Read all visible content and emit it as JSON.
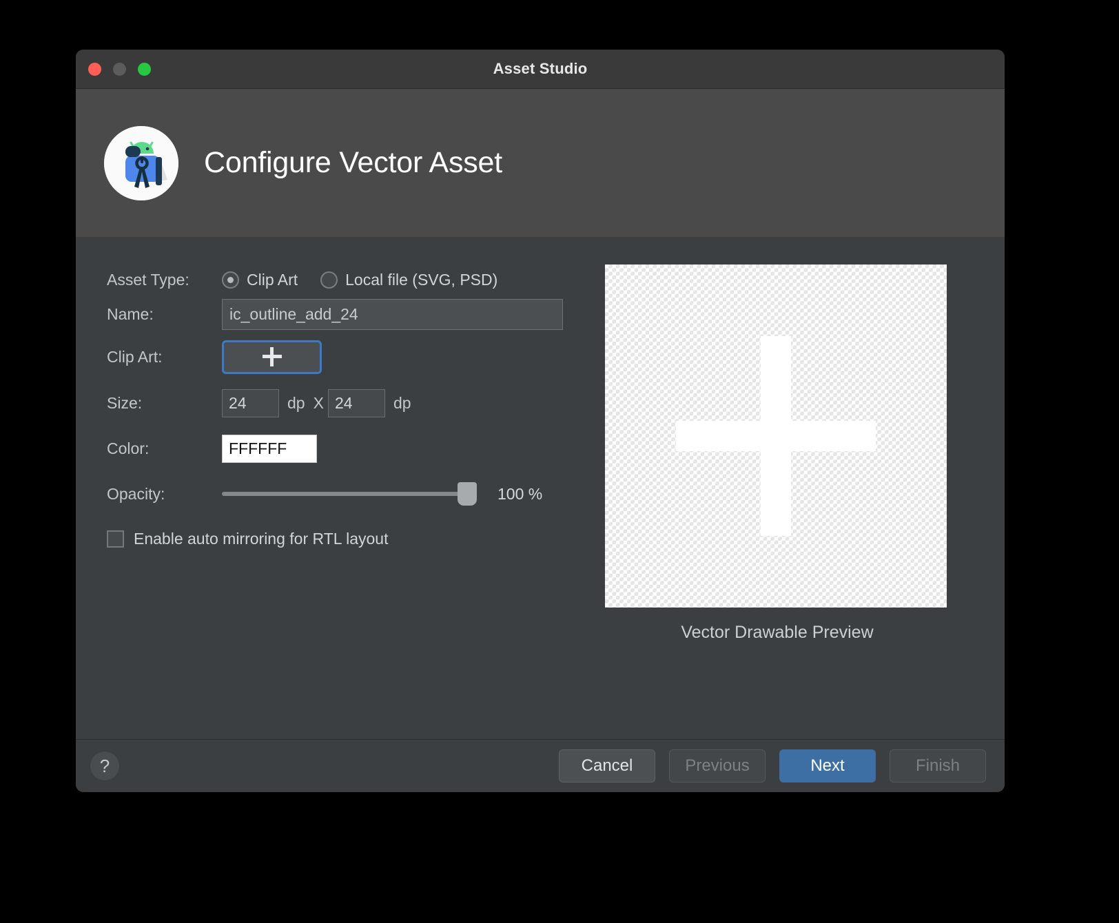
{
  "window": {
    "title": "Asset Studio",
    "traffic_lights": [
      "close",
      "minimize",
      "zoom"
    ]
  },
  "header": {
    "title": "Configure Vector Asset",
    "logo_icon": "android-studio-logo-icon"
  },
  "form": {
    "asset_type": {
      "label": "Asset Type:",
      "options": [
        {
          "label": "Clip Art",
          "selected": true
        },
        {
          "label": "Local file (SVG, PSD)",
          "selected": false
        }
      ]
    },
    "name": {
      "label": "Name:",
      "value": "ic_outline_add_24",
      "placeholder": "Name"
    },
    "clip_art": {
      "label": "Clip Art:",
      "button_icon": "plus-icon"
    },
    "size": {
      "label": "Size:",
      "width": "24",
      "height": "24",
      "unit_width": "dp",
      "unit_height": "dp",
      "separator": "X"
    },
    "color": {
      "label": "Color:",
      "value": "FFFFFF",
      "swatch_hex": "#FFFFFF"
    },
    "opacity": {
      "label": "Opacity:",
      "value": 100,
      "value_text": "100 %",
      "min": 0,
      "max": 100
    },
    "rtl": {
      "label": "Enable auto mirroring for RTL layout",
      "checked": false
    }
  },
  "preview": {
    "caption": "Vector Drawable Preview",
    "drawable_icon": "plus-icon"
  },
  "footer": {
    "help_label": "?",
    "buttons": [
      {
        "label": "Cancel",
        "state": "enabled"
      },
      {
        "label": "Previous",
        "state": "disabled"
      },
      {
        "label": "Next",
        "state": "primary"
      },
      {
        "label": "Finish",
        "state": "disabled"
      }
    ]
  },
  "colors": {
    "accent": "#3d6fa5",
    "focus_border": "#3d79c4",
    "window_bg": "#3c3f41",
    "header_bg": "#4a4a4a",
    "titlebar_bg": "#3a3a3a"
  }
}
